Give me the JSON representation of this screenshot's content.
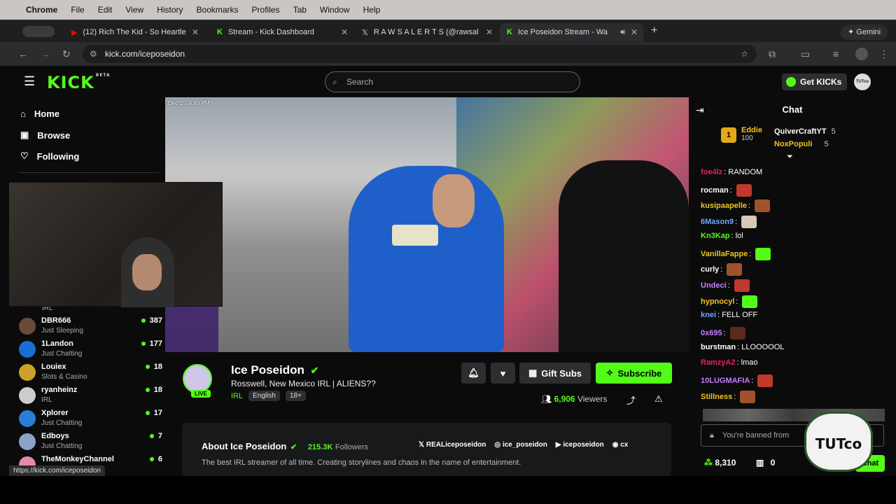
{
  "menubar": {
    "items": [
      "Chrome",
      "File",
      "Edit",
      "View",
      "History",
      "Bookmarks",
      "Profiles",
      "Tab",
      "Window",
      "Help"
    ]
  },
  "tabs": [
    {
      "label": "(12) Rich The Kid - So Heartle",
      "icon": "youtube-icon"
    },
    {
      "label": "Stream - Kick Dashboard",
      "icon": "kick-icon"
    },
    {
      "label": "R A W S A L E R T S (@rawsal",
      "icon": "x-icon"
    },
    {
      "label": "Ice Poseidon Stream - Wa",
      "icon": "kick-icon",
      "active": true
    }
  ],
  "gemini_label": "Gemini",
  "url": "kick.com/iceposeidon",
  "kick": {
    "logo": "KICK",
    "logo_beta": "BETA",
    "search_placeholder": "Search",
    "get_kicks": "Get KICKs",
    "avatar_text": "TUTco"
  },
  "sidebar": {
    "nav": [
      {
        "label": "Home",
        "icon": "home-icon"
      },
      {
        "label": "Browse",
        "icon": "browse-icon"
      },
      {
        "label": "Following",
        "icon": "heart-icon"
      }
    ],
    "partial_category": "IRL",
    "channels": [
      {
        "name": "DBR666",
        "category": "Just Sleeping",
        "viewers": "387",
        "color": "#6b4a3a"
      },
      {
        "name": "1Landon",
        "category": "Just Chatting",
        "viewers": "177",
        "color": "#1a6fd4"
      },
      {
        "name": "Louiex",
        "category": "Slots & Casino",
        "viewers": "18",
        "color": "#c9a227"
      },
      {
        "name": "ryanheinz",
        "category": "IRL",
        "viewers": "18",
        "color": "#cccccc"
      },
      {
        "name": "Xplorer",
        "category": "Just Chatting",
        "viewers": "17",
        "color": "#2a7fd4"
      },
      {
        "name": "Edboys",
        "category": "Just Chatting",
        "viewers": "7",
        "color": "#8aa4c8"
      },
      {
        "name": "TheMonkeyChannel",
        "category": "",
        "viewers": "6",
        "color": "#e58aa8"
      }
    ]
  },
  "video": {
    "timestamp": "Dec 15, 4:49 PM"
  },
  "stream": {
    "streamer": "Ice Poseidon",
    "title": "Rosswell, New Mexico IRL | ALIENS??",
    "category": "IRL",
    "tags": [
      "English",
      "18+"
    ],
    "live": "LIVE",
    "viewers": "6,906",
    "viewers_label": "Viewers",
    "gift_subs": "Gift Subs",
    "subscribe": "Subscribe"
  },
  "about": {
    "heading": "About Ice Poseidon",
    "followers": "215.3K",
    "followers_label": "Followers",
    "bio": "The best IRL streamer of all time. Creating storylines and chaos in the name of entertainment.",
    "socials": [
      {
        "label": "REALiceposeidon",
        "icon": "x-icon"
      },
      {
        "label": "ice_poseidon",
        "icon": "instagram-icon"
      },
      {
        "label": "iceposeidon",
        "icon": "youtube-icon"
      },
      {
        "label": "cx",
        "icon": "discord-icon"
      }
    ]
  },
  "chat": {
    "title": "Chat",
    "leaders": [
      {
        "name": "Eddie",
        "points": "100"
      },
      {
        "name": "QuiverCraftYT",
        "points": "5"
      },
      {
        "name": "NoxPopuli",
        "points": "5"
      }
    ],
    "messages": [
      {
        "user": "foe4lz",
        "color": "#e0245e",
        "text": ": RANDOM",
        "emote": ""
      },
      {
        "user": "rocman",
        "color": "#ffffff",
        "text": ":",
        "emote": "#c0392b"
      },
      {
        "user": "kusipaapelle",
        "color": "#f0c419",
        "text": ":",
        "emote": "#a0522d"
      },
      {
        "user": "6Mason9",
        "color": "#6ea8fe",
        "text": ":",
        "emote": "#d8c8b8"
      },
      {
        "user": "Kn3Kap",
        "color": "#53fc18",
        "text": ": lol",
        "emote": ""
      },
      {
        "user": "VanillaFappe",
        "color": "#f0c419",
        "text": ":",
        "emote": "#53fc18"
      },
      {
        "user": "curly",
        "color": "#ffffff",
        "text": ":",
        "emote": "#a0522d"
      },
      {
        "user": "Undeci",
        "color": "#c77dff",
        "text": ":",
        "emote": "#c0392b"
      },
      {
        "user": "hypnocyl",
        "color": "#f0c419",
        "text": ":",
        "emote": "#53fc18"
      },
      {
        "user": "knei",
        "color": "#6ea8fe",
        "text": ": FELL OFF",
        "emote": ""
      },
      {
        "user": "0x695",
        "color": "#c77dff",
        "text": ":",
        "emote": "#5a2a1a"
      },
      {
        "user": "burstman",
        "color": "#ffffff",
        "text": ": LLOOOOOL",
        "emote": ""
      },
      {
        "user": "RamzyA2",
        "color": "#e0245e",
        "text": ": lmao",
        "emote": ""
      },
      {
        "user": "10LUGMAFIA",
        "color": "#c77dff",
        "text": ":",
        "emote": "#c0392b"
      },
      {
        "user": "Stillness",
        "color": "#f0c419",
        "text": ":",
        "emote": "#a0522d"
      }
    ],
    "banned_placeholder": "You're banned from",
    "kicks_balance": "8,310",
    "items_count": "0",
    "chat_button": "Chat"
  },
  "status_url": "https://kick.com/iceposeidon",
  "watermark": "TUTco"
}
